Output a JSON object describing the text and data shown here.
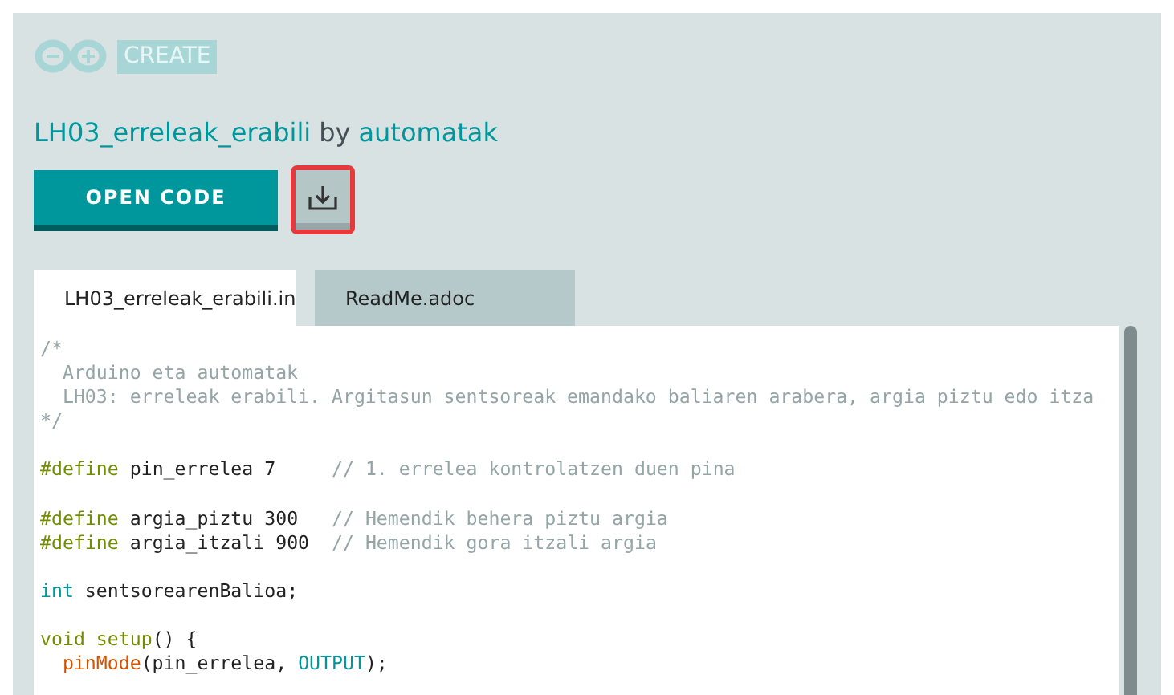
{
  "header": {
    "logo_text": "CREATE"
  },
  "sketch": {
    "name": "LH03_erreleak_erabili",
    "by": "by",
    "author": "automatak"
  },
  "actions": {
    "open_button": "OPEN CODE"
  },
  "tabs": [
    {
      "label": "LH03_erreleak_erabili.in",
      "selected": true
    },
    {
      "label": "ReadMe.adoc",
      "selected": false
    }
  ],
  "code_lines": [
    {
      "kind": "code",
      "tokens": [
        {
          "kind": "comment",
          "text": "/*"
        }
      ]
    },
    {
      "kind": "code",
      "tokens": [
        {
          "kind": "comment",
          "text": "  Arduino eta automatak"
        }
      ]
    },
    {
      "kind": "code",
      "tokens": [
        {
          "kind": "comment",
          "text": "  LH03: erreleak erabili. Argitasun sentsoreak emandako baliaren arabera, argia piztu edo itza"
        }
      ]
    },
    {
      "kind": "code",
      "tokens": [
        {
          "kind": "comment",
          "text": "*/"
        }
      ]
    },
    {
      "kind": "blank"
    },
    {
      "kind": "code",
      "tokens": [
        {
          "kind": "directive",
          "text": "#define"
        },
        {
          "kind": "plain",
          "text": " pin_errelea 7     "
        },
        {
          "kind": "comment",
          "text": "// 1. errelea kontrolatzen duen pina"
        }
      ]
    },
    {
      "kind": "blank"
    },
    {
      "kind": "code",
      "tokens": [
        {
          "kind": "directive",
          "text": "#define"
        },
        {
          "kind": "plain",
          "text": " argia_piztu 300   "
        },
        {
          "kind": "comment",
          "text": "// Hemendik behera piztu argia"
        }
      ]
    },
    {
      "kind": "code",
      "tokens": [
        {
          "kind": "directive",
          "text": "#define"
        },
        {
          "kind": "plain",
          "text": " argia_itzali 900  "
        },
        {
          "kind": "comment",
          "text": "// Hemendik gora itzali argia"
        }
      ]
    },
    {
      "kind": "blank"
    },
    {
      "kind": "code",
      "tokens": [
        {
          "kind": "type",
          "text": "int"
        },
        {
          "kind": "plain",
          "text": " sentsorearenBalioa;"
        }
      ]
    },
    {
      "kind": "blank"
    },
    {
      "kind": "code",
      "tokens": [
        {
          "kind": "keyword",
          "text": "void"
        },
        {
          "kind": "keyword",
          "text": " setup"
        },
        {
          "kind": "plain",
          "text": "() {"
        }
      ]
    },
    {
      "kind": "code",
      "tokens": [
        {
          "kind": "function",
          "text": "  pinMode"
        },
        {
          "kind": "plain",
          "text": "(pin_errelea, "
        },
        {
          "kind": "constant",
          "text": "OUTPUT"
        },
        {
          "kind": "plain",
          "text": ");"
        }
      ]
    }
  ]
}
